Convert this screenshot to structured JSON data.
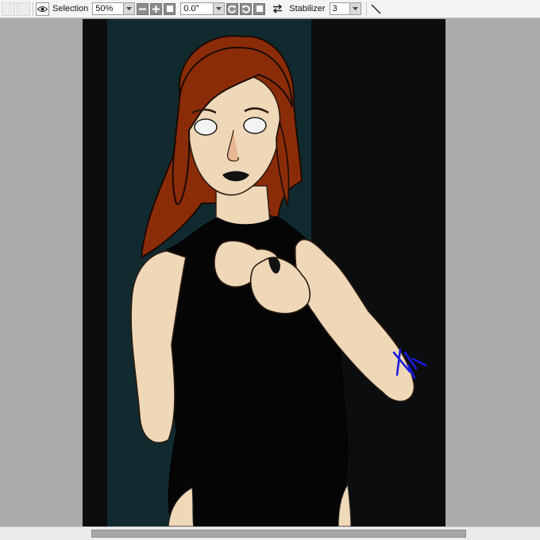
{
  "toolbar": {
    "selection_label": "Selection",
    "zoom_value": "50%",
    "rotation_value": "0.0°",
    "stabilizer_label": "Stabilizer",
    "stabilizer_value": "3",
    "icons": {
      "view": "eye-icon",
      "zoom_out": "zoom-out-icon",
      "zoom_in": "zoom-in-icon",
      "zoom_reset": "zoom-reset-icon",
      "rotate_ccw": "rotate-ccw-icon",
      "rotate_cw": "rotate-cw-icon",
      "rotate_reset": "rotate-reset-icon",
      "flip": "flip-horizontal-icon",
      "pen_tool": "pen-line-icon"
    }
  },
  "canvas": {
    "content": "illustration of a red-haired woman in a black bodysuit",
    "colors": {
      "background": "#0b0d0f",
      "panel": "#112a30",
      "hair": "#8b2c08",
      "skin": "#efd8b8",
      "suit": "#050505",
      "signature": "#1a1ae0"
    }
  },
  "scrollbar": {
    "horizontal_position": 0.17
  }
}
